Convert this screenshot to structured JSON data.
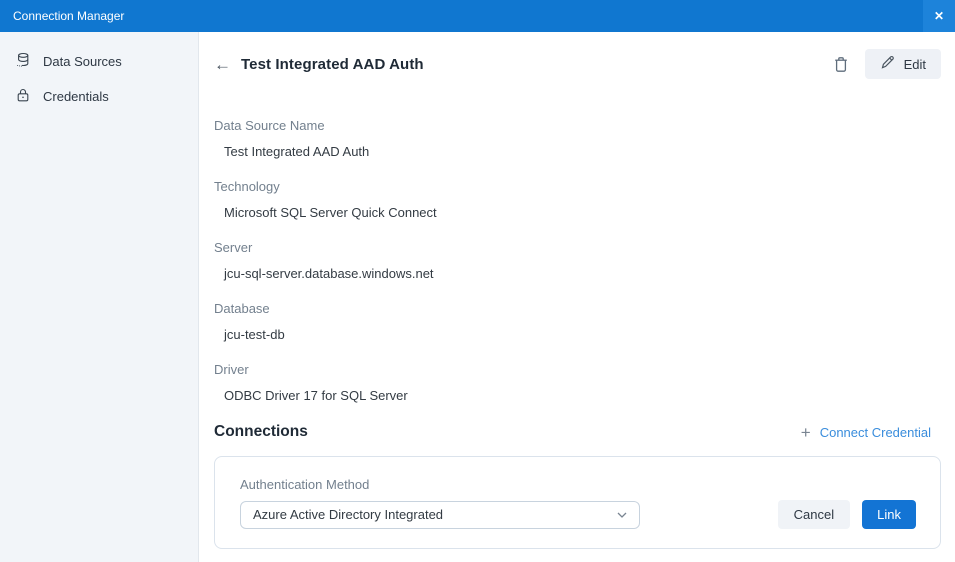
{
  "colors": {
    "titlebar_blue": "#1077d0",
    "close_button_blue": "#1d83da",
    "sidebar_bg": "#f2f5f9",
    "label_gray": "#73808e",
    "heading_navy": "#1f2a36",
    "link_blue": "#3a8ddc",
    "primary_button_blue": "#1374d4"
  },
  "titlebar": {
    "title": "Connection Manager",
    "close_glyph": "✕"
  },
  "sidebar": {
    "items": [
      {
        "label": "Data Sources",
        "icon": "database-icon"
      },
      {
        "label": "Credentials",
        "icon": "lock-icon"
      }
    ]
  },
  "header": {
    "back_glyph": "←",
    "title": "Test Integrated AAD Auth",
    "edit_label": "Edit"
  },
  "fields": [
    {
      "label": "Data Source Name",
      "value": "Test Integrated AAD Auth"
    },
    {
      "label": "Technology",
      "value": "Microsoft SQL Server Quick Connect"
    },
    {
      "label": "Server",
      "value": "jcu-sql-server.database.windows.net"
    },
    {
      "label": "Database",
      "value": "jcu-test-db"
    },
    {
      "label": "Driver",
      "value": "ODBC Driver 17 for SQL Server"
    }
  ],
  "connections": {
    "heading": "Connections",
    "plus_glyph": "+",
    "connect_credential_label": "Connect Credential",
    "card": {
      "auth_method_label": "Authentication Method",
      "auth_method_value": "Azure Active Directory Integrated",
      "cancel_label": "Cancel",
      "link_label": "Link"
    }
  }
}
